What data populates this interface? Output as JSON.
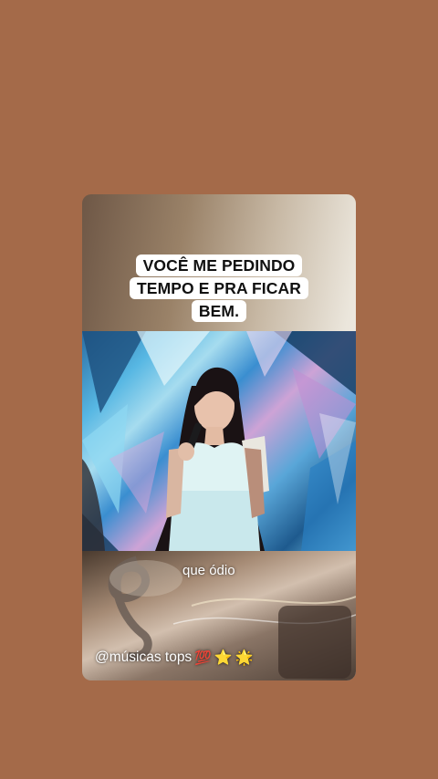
{
  "caption": {
    "line1": "VOCÊ ME PEDINDO",
    "line2": "TEMPO E PRA FICAR",
    "line3": "BEM."
  },
  "subtitle": "que ódio",
  "handle": {
    "text": "@músicas tops",
    "emojis": [
      "💯",
      "⭐",
      "🌟"
    ]
  },
  "colors": {
    "background": "#a46a49",
    "caption_bg": "#ffffff",
    "stage_blue": "#57b7e3"
  }
}
